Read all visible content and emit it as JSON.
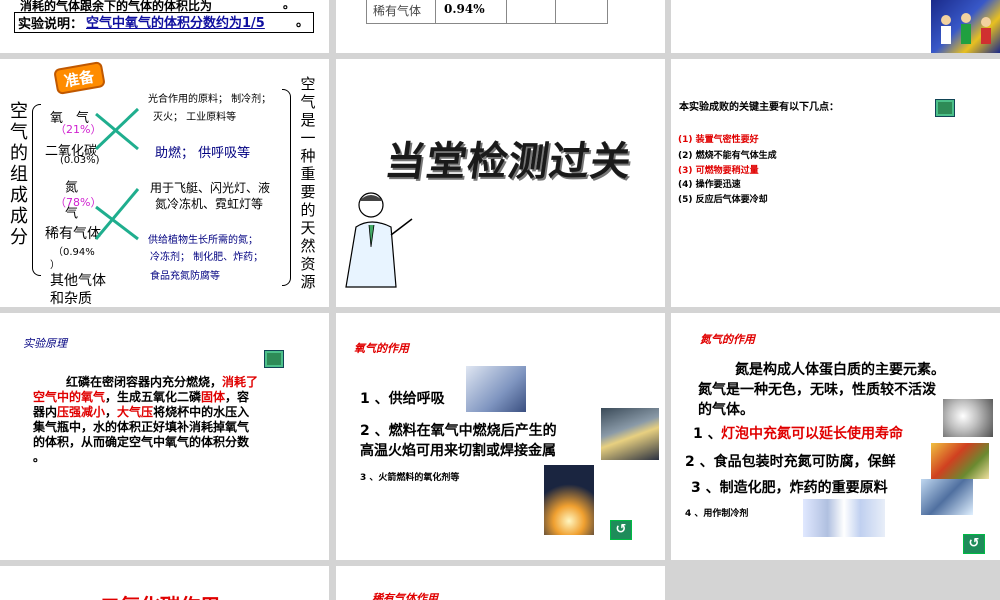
{
  "slide1": {
    "line1": "消耗的气体跟余下的气体的体积比为",
    "line1_dot": "。",
    "note_label": "实验说明：",
    "note_value": "空气中氧气的体积分数约为1/5",
    "note_end": "。"
  },
  "slide2": {
    "cell_gas": "稀有气体",
    "cell_pct": "0.94%"
  },
  "slide4": {
    "badge": "准备",
    "left_title": "空气的组成成分",
    "oxygen": "氧　气",
    "oxygen_pct": "（21%）",
    "co2": "二氧化碳",
    "co2_pct": "(0.03%)",
    "nitrogen": "氮　气",
    "nitrogen_pct": "（78%）",
    "rare_gas": "稀有气体",
    "rare_pct": "（0.94%",
    "rare_close": "）",
    "other": "其他气体",
    "other2": "和杂质",
    "use1": "光合作用的原料；  制冷剂；",
    "use2": "灭火；    工业原料等",
    "use3": "助燃；  供呼吸等",
    "use4": "用于飞艇、闪光灯、液",
    "use5": "氮冷冻机、霓虹灯等",
    "use6": "供给植物生长所需的氮；",
    "use7": "冷冻剂；     制化肥、炸药；",
    "use8": "食品充氮防腐等",
    "right_title": "空气是一种重要的天然资源"
  },
  "slide5": {
    "title": "当堂检测过关"
  },
  "slide6": {
    "heading": "本实验成败的关键主要有以下几点：",
    "items": [
      "(1) 装置气密性要好",
      "(2) 燃烧不能有气体生成",
      "(3) 可燃物要稍过量",
      "(4) 操作要迅速",
      "(5) 反应后气体要冷却"
    ]
  },
  "slide7": {
    "title": "实验原理",
    "p1": "红磷在密闭容器内充分燃烧，",
    "p1_red": "消耗了",
    "p2_red": "空气中的氧气",
    "p2": "，生成五氧化二磷",
    "p2_red2": "固体",
    "p2_end": "，容",
    "p3": "器内",
    "p3_red": "压强减小",
    "p3_mid": "，",
    "p3_red2": "大气压",
    "p3_end": "将烧杯中的水压入",
    "p4": "集气瓶中，水的体积正好填补消耗掉氧气",
    "p5": "的体积，从而确定空气中氧气的体积分数",
    "p6": "。"
  },
  "slide8": {
    "title": "氧气的作用",
    "item1": "1 、供给呼吸",
    "item2a": "2 、燃料在氧气中燃烧后产生的",
    "item2b": "高温火焰可用来切割或焊接金属",
    "item3": "3 、火箭燃料的氧化剂等"
  },
  "slide9": {
    "title": "氮气的作用",
    "p1": "氮是构成人体蛋白质的主要元素。",
    "p2": "氮气是一种无色，无味，性质较不活泼",
    "p3": "的气体。",
    "item1_num": "1 、",
    "item1": "灯泡中充氮可以延长使用寿命",
    "item2": "2 、食品包装时充氮可防腐，保鲜",
    "item3": "3 、制造化肥，炸药的重要原料",
    "item4": "4 、用作制冷剂"
  },
  "slide10": {
    "title": "二氧化碳作用"
  },
  "slide11": {
    "title": "稀有气体作用"
  },
  "colors": {
    "accent_red": "#e00000",
    "accent_blue": "#1010a0",
    "pink": "#d020d0",
    "button_green": "#2e8b57"
  }
}
